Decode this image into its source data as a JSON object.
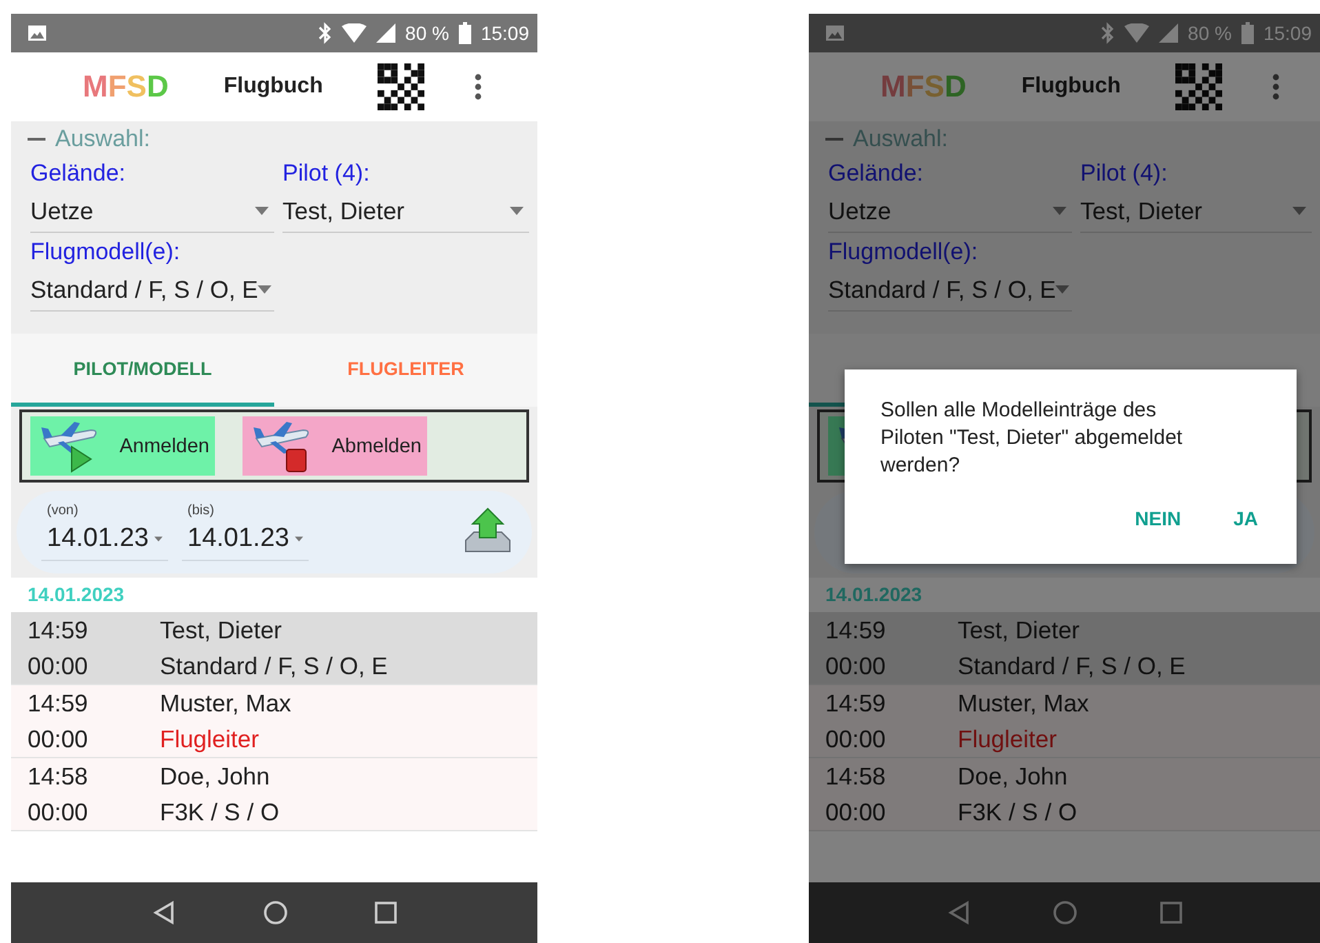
{
  "phones": [
    {
      "status_bar": {
        "battery": "80 %",
        "time": "15:09"
      },
      "app_bar": {
        "logo": "MFSD",
        "title": "Flugbuch"
      },
      "selection": {
        "heading": "Auswahl:",
        "expanded": true,
        "fields": [
          {
            "label": "Gelände:",
            "value": "Uetze"
          },
          {
            "label": "Pilot (4):",
            "value": "Test, Dieter"
          },
          {
            "label": "Flugmodell(e):",
            "value": "Standard / F, S / O, E"
          }
        ]
      },
      "tabs": [
        {
          "label": "PILOT/MODELL",
          "selected": true
        },
        {
          "label": "FLUGLEITER",
          "selected": false
        }
      ],
      "actions": [
        {
          "label": "Anmelden",
          "kind": "sign-in"
        },
        {
          "label": "Abmelden",
          "kind": "sign-out"
        }
      ],
      "date_range": {
        "from_label": "(von)",
        "from": "14.01.23",
        "to_label": "(bis)",
        "to": "14.01.23"
      },
      "log": {
        "date": "14.01.2023",
        "entries": [
          {
            "time": "14:59",
            "pilot": "Test, Dieter",
            "duration": "00:00",
            "model": "Standard / F, S / O, E",
            "kind": "model",
            "selected": true
          },
          {
            "time": "14:59",
            "pilot": "Muster, Max",
            "duration": "00:00",
            "model": "Flugleiter",
            "kind": "director",
            "selected": false
          },
          {
            "time": "14:58",
            "pilot": "Doe, John",
            "duration": "00:00",
            "model": "F3K / S / O",
            "kind": "model",
            "selected": false
          }
        ]
      }
    },
    {
      "status_bar": {
        "battery": "80 %",
        "time": "15:09"
      },
      "app_bar": {
        "logo": "MFSD",
        "title": "Flugbuch"
      },
      "selection": {
        "heading": "Auswahl:",
        "expanded": true,
        "fields": [
          {
            "label": "Gelände:",
            "value": "Uetze"
          },
          {
            "label": "Pilot (4):",
            "value": "Test, Dieter"
          },
          {
            "label": "Flugmodell(e):",
            "value": "Standard / F, S / O, E"
          }
        ]
      },
      "tabs": [
        {
          "selected": true
        }
      ],
      "actions": [
        {
          "kind": "sign-in"
        }
      ],
      "log": {
        "date": "14.01.2023",
        "entries": [
          {
            "time": "14:59",
            "pilot": "Test, Dieter",
            "duration": "00:00",
            "model": "Standard / F, S / O, E",
            "kind": "model",
            "selected": true
          },
          {
            "time": "14:59",
            "pilot": "Muster, Max",
            "duration": "00:00",
            "model": "Flugleiter",
            "kind": "director",
            "selected": false
          },
          {
            "time": "14:58",
            "pilot": "Doe, John",
            "duration": "00:00",
            "model": "F3K / S / O",
            "kind": "model",
            "selected": false
          }
        ]
      },
      "dialog": {
        "message": "Sollen alle Modelleinträge des Piloten \"Test, Dieter\" abgemeldet werden?",
        "buttons": [
          "NEIN",
          "JA"
        ]
      }
    }
  ]
}
